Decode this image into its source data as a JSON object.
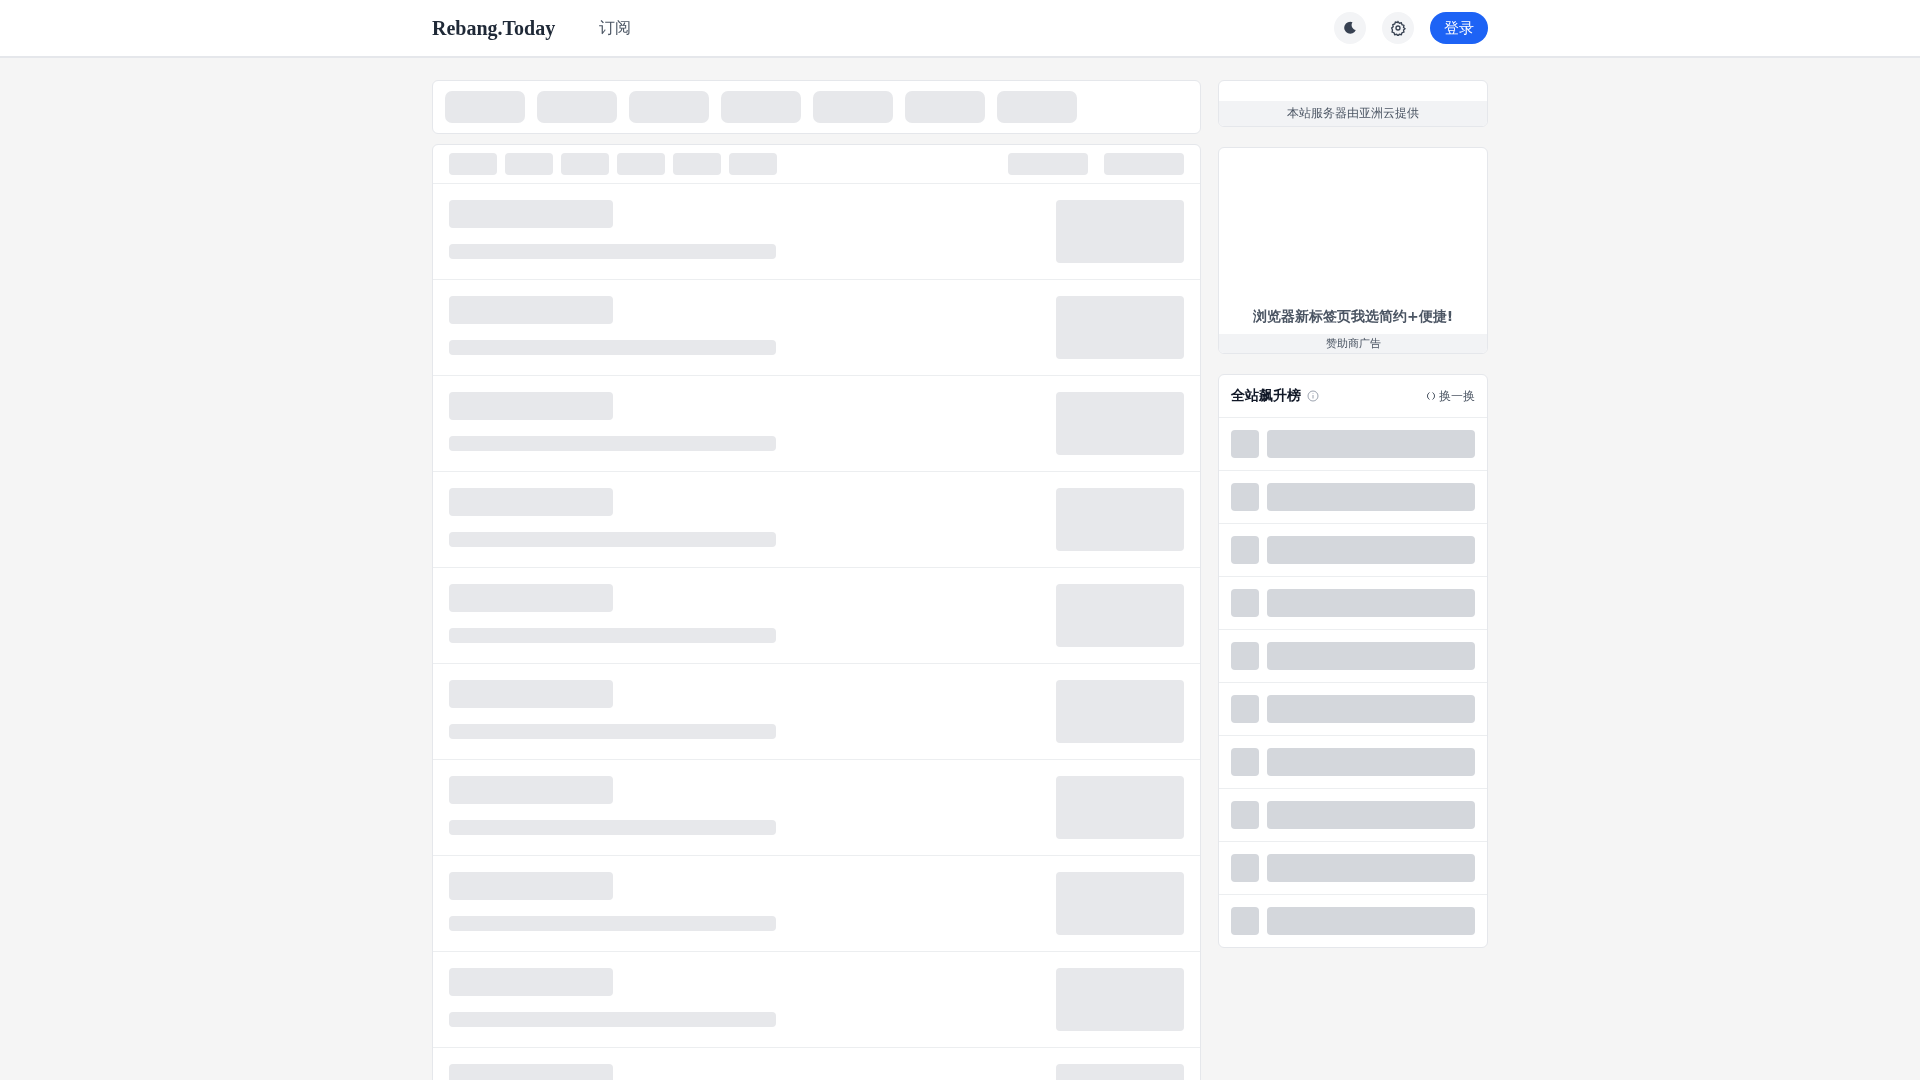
{
  "header": {
    "logo": "Rebang.Today",
    "nav": [
      {
        "label": "订阅"
      }
    ],
    "login_button": "登录"
  },
  "sidebar": {
    "hosting_note": "本站服务器由亚洲云提供",
    "ad": {
      "headline": "浏览器新标签页我选简约+便捷!",
      "footer": "赞助商广告"
    },
    "hot_list": {
      "title": "全站飙升榜",
      "refresh": "换一换"
    }
  }
}
